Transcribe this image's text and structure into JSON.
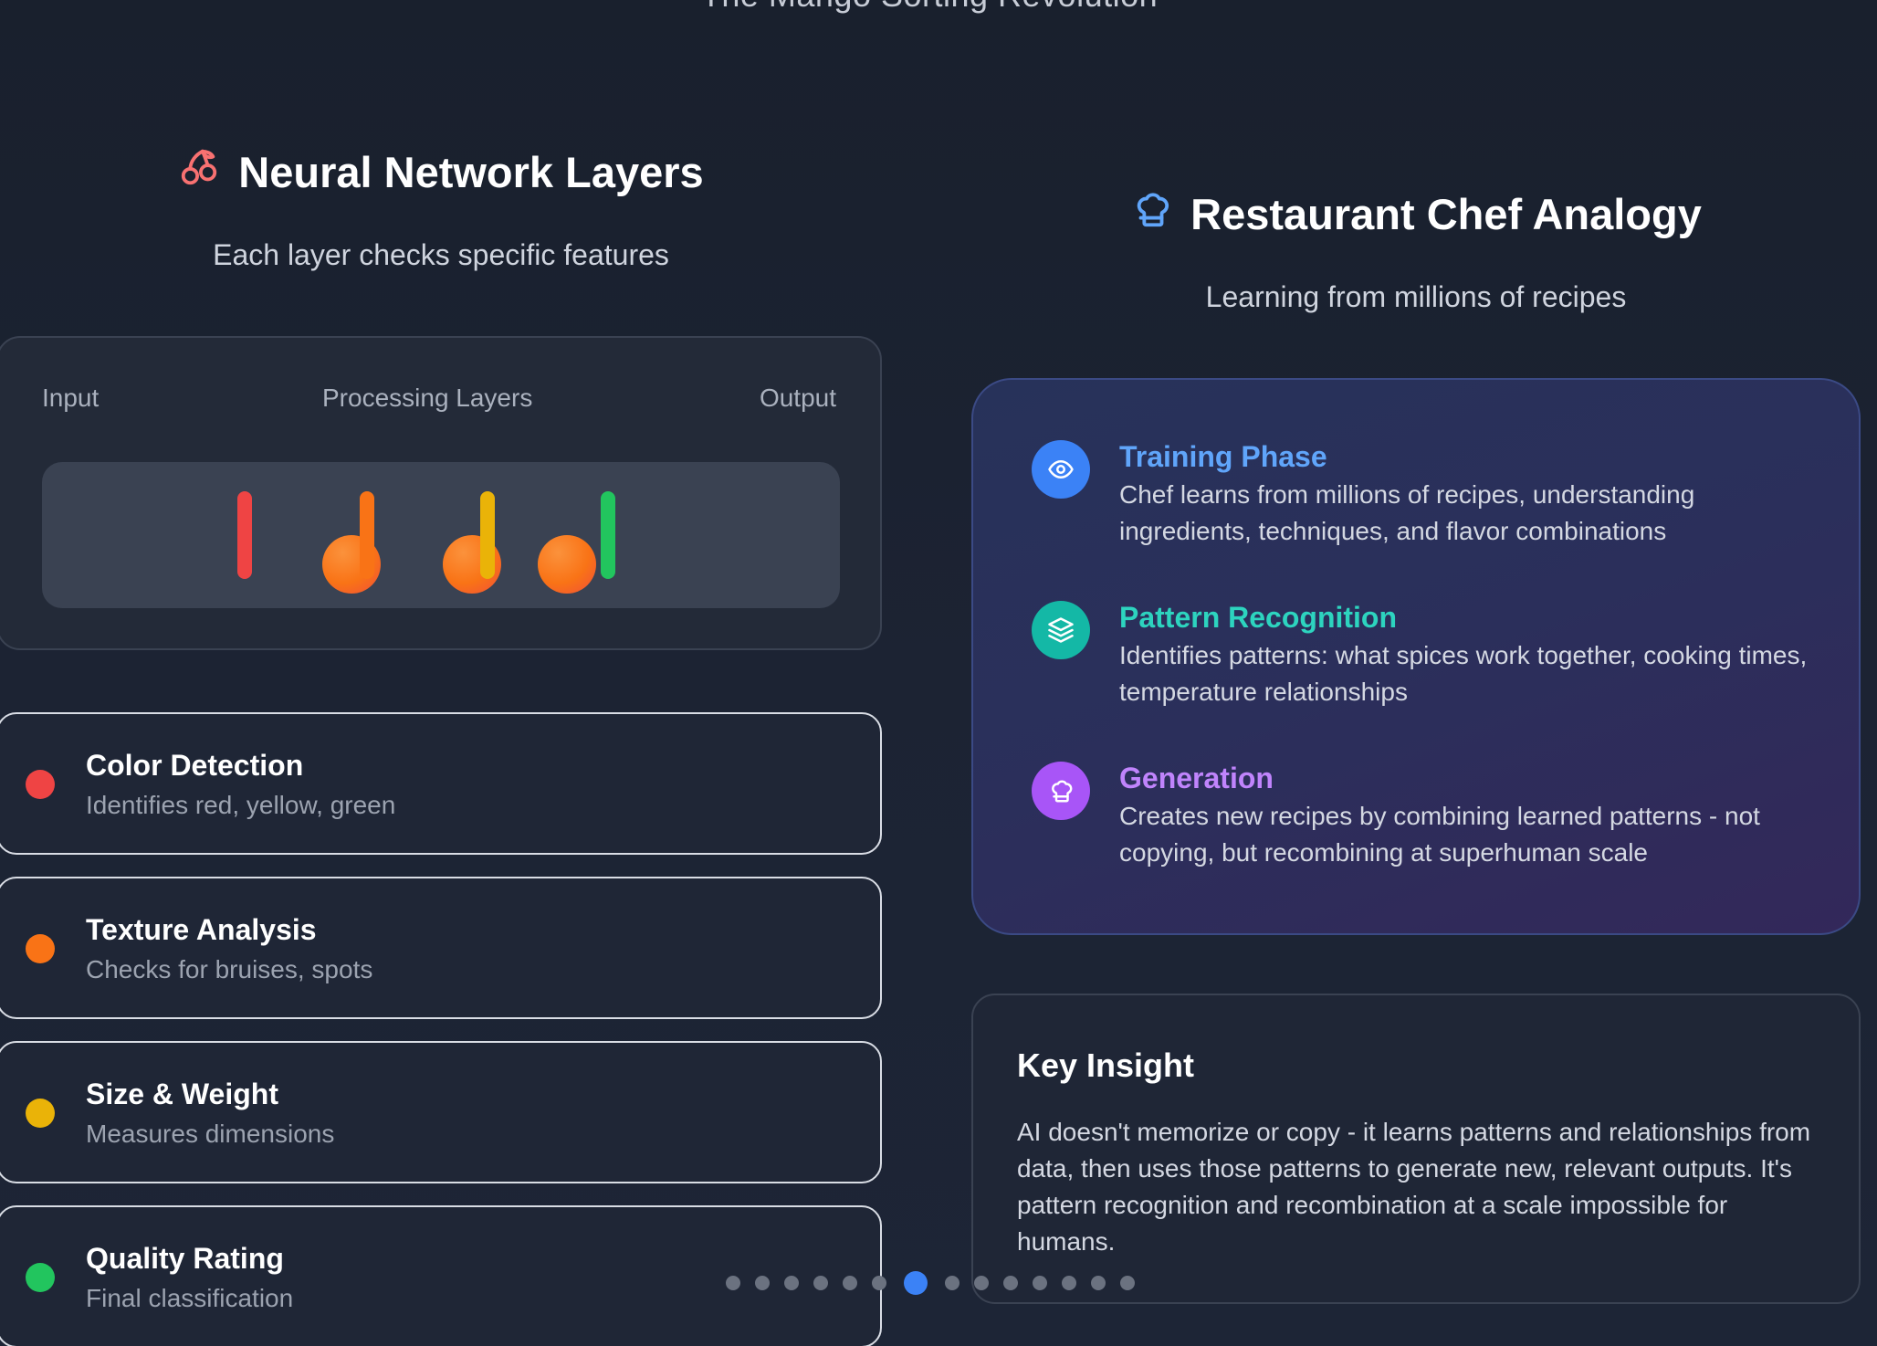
{
  "page_title": "The Mango Sorting Revolution",
  "left": {
    "title": "Neural Network Layers",
    "subtitle": "Each layer checks specific features",
    "icon": "cherries-icon",
    "diagram": {
      "input_label": "Input",
      "processing_label": "Processing Layers",
      "output_label": "Output"
    },
    "features": [
      {
        "title": "Color Detection",
        "description": "Identifies red, yellow, green",
        "color": "#ef4444"
      },
      {
        "title": "Texture Analysis",
        "description": "Checks for bruises, spots",
        "color": "#f97316"
      },
      {
        "title": "Size & Weight",
        "description": "Measures dimensions",
        "color": "#eab308"
      },
      {
        "title": "Quality Rating",
        "description": "Final classification",
        "color": "#22c55e"
      }
    ]
  },
  "right": {
    "title": "Restaurant Chef Analogy",
    "subtitle": "Learning from millions of recipes",
    "icon": "chef-hat-icon",
    "steps": [
      {
        "title": "Training Phase",
        "description": "Chef learns from millions of recipes, understanding ingredients, techniques, and flavor combinations",
        "icon": "eye-icon",
        "color": "#3b82f6",
        "title_color": "#60a5fa"
      },
      {
        "title": "Pattern Recognition",
        "description": "Identifies patterns: what spices work together, cooking times, temperature relationships",
        "icon": "layers-icon",
        "color": "#14b8a6",
        "title_color": "#2dd4bf"
      },
      {
        "title": "Generation",
        "description": "Creates new recipes by combining learned patterns - not copying, but recombining at superhuman scale",
        "icon": "chef-hat-icon",
        "color": "#a855f7",
        "title_color": "#c084fc"
      }
    ],
    "insight": {
      "title": "Key Insight",
      "body": "AI doesn't memorize or copy - it learns patterns and relationships from data, then uses those patterns to generate new, relevant outputs. It's pattern recognition and recombination at a scale impossible for humans."
    }
  },
  "pagination": {
    "total": 14,
    "current": 7
  },
  "colors": {
    "accent": "#3b82f6",
    "layer_red": "#ef4444",
    "layer_orange": "#f97316",
    "layer_yellow": "#eab308",
    "layer_green": "#22c55e"
  }
}
